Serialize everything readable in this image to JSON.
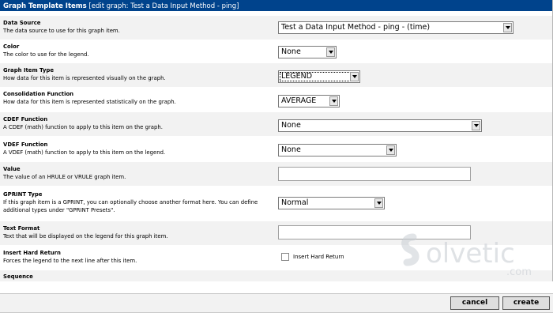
{
  "header": {
    "title": "Graph Template Items",
    "subtitle": "[edit graph: Test a Data Input Method - ping]"
  },
  "fields": [
    {
      "title": "Data Source",
      "desc": "The data source to use for this graph item.",
      "value": "Test a Data Input Method - ping - (time)"
    },
    {
      "title": "Color",
      "desc": "The color to use for the legend.",
      "value": "None"
    },
    {
      "title": "Graph Item Type",
      "desc": "How data for this item is represented visually on the graph.",
      "value": "LEGEND"
    },
    {
      "title": "Consolidation Function",
      "desc": "How data for this item is represented statistically on the graph.",
      "value": "AVERAGE"
    },
    {
      "title": "CDEF Function",
      "desc": "A CDEF (math) function to apply to this item on the graph.",
      "value": "None"
    },
    {
      "title": "VDEF Function",
      "desc": "A VDEF (math) function to apply to this item on the legend.",
      "value": "None"
    },
    {
      "title": "Value",
      "desc": "The value of an HRULE or VRULE graph item.",
      "value": ""
    },
    {
      "title": "GPRINT Type",
      "desc": "If this graph item is a GPRINT, you can optionally choose another format here. You can define additional types under \"GPRINT Presets\".",
      "value": "Normal"
    },
    {
      "title": "Text Format",
      "desc": "Text that will be displayed on the legend for this graph item.",
      "value": ""
    },
    {
      "title": "Insert Hard Return",
      "desc": "Forces the legend to the next line after this item.",
      "checkbox_label": "Insert Hard Return"
    },
    {
      "title": "Sequence"
    }
  ],
  "watermark": {
    "brand": "olvetic",
    "domain": ".com"
  },
  "buttons": {
    "cancel": "cancel",
    "create": "create"
  }
}
